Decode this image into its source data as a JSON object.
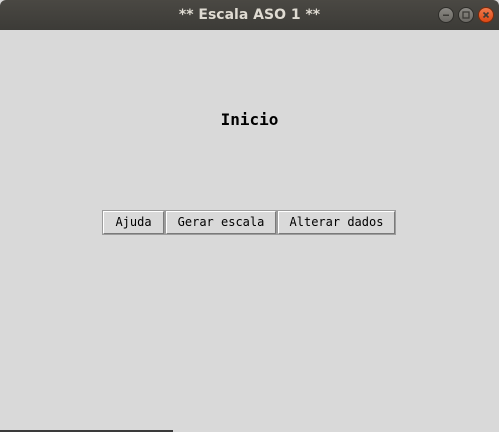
{
  "window": {
    "title": "** Escala ASO 1 **"
  },
  "main": {
    "heading": "Inicio",
    "buttons": {
      "help": "Ajuda",
      "generate": "Gerar escala",
      "edit": "Alterar dados"
    }
  },
  "icons": [
    "minimize-icon",
    "maximize-icon",
    "close-icon"
  ],
  "colors": {
    "titlebar": "#3c3b37",
    "background": "#d9d9d9",
    "close_button": "#dd4814"
  }
}
